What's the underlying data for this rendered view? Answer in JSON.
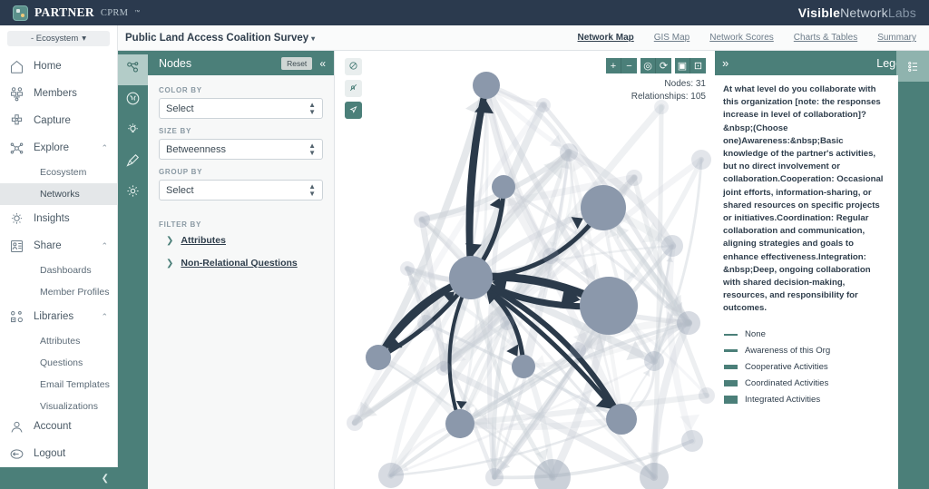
{
  "topbar": {
    "brand_name": "PARTNER",
    "brand_sub": "CPRM",
    "brand_tm": "™",
    "logo_icon": "partner-logo-icon",
    "right_brand": {
      "part1": "Visible",
      "part2": "Network",
      "part3": "Labs"
    }
  },
  "sidebar": {
    "ecosystem_selector": "- Ecosystem",
    "ecosystem_caret": "▾",
    "items": [
      {
        "label": "Home",
        "icon": "home-icon",
        "chevron": ""
      },
      {
        "label": "Members",
        "icon": "members-icon",
        "chevron": ""
      },
      {
        "label": "Capture",
        "icon": "capture-icon",
        "chevron": ""
      },
      {
        "label": "Explore",
        "icon": "explore-icon",
        "chevron": "⌃"
      },
      {
        "label": "Insights",
        "icon": "insights-icon",
        "chevron": ""
      },
      {
        "label": "Share",
        "icon": "share-icon",
        "chevron": "⌃"
      },
      {
        "label": "Libraries",
        "icon": "libraries-icon",
        "chevron": "⌃"
      }
    ],
    "explore_sub": [
      {
        "label": "Ecosystem",
        "active": false
      },
      {
        "label": "Networks",
        "active": true
      }
    ],
    "share_sub": [
      {
        "label": "Dashboards",
        "active": false
      },
      {
        "label": "Member Profiles",
        "active": false
      }
    ],
    "libraries_sub": [
      {
        "label": "Attributes",
        "active": false
      },
      {
        "label": "Questions",
        "active": false
      },
      {
        "label": "Email Templates",
        "active": false
      },
      {
        "label": "Visualizations",
        "active": false
      }
    ],
    "bottom_items": [
      {
        "label": "Account",
        "icon": "account-icon"
      },
      {
        "label": "Logout",
        "icon": "logout-icon"
      }
    ],
    "collapse_glyph": "❮"
  },
  "header": {
    "survey_title": "Public Land Access Coalition Survey",
    "survey_caret": "▾",
    "tabs": [
      {
        "label": "Network Map",
        "active": true
      },
      {
        "label": "GIS Map",
        "active": false
      },
      {
        "label": "Network Scores",
        "active": false
      },
      {
        "label": "Charts & Tables",
        "active": false
      },
      {
        "label": "Summary",
        "active": false
      }
    ]
  },
  "rail": [
    {
      "name": "nodes-tool",
      "icon": "network-nodes-icon",
      "active": true
    },
    {
      "name": "clusters-tool",
      "icon": "clusters-icon",
      "active": false
    },
    {
      "name": "insights-tool",
      "icon": "lightbulb-icon",
      "active": false
    },
    {
      "name": "style-tool",
      "icon": "paintbrush-icon",
      "active": false
    },
    {
      "name": "settings-tool",
      "icon": "gear-icon",
      "active": false
    }
  ],
  "nodes_panel": {
    "title": "Nodes",
    "reset_label": "Reset",
    "collapse_glyph": "«",
    "fields": [
      {
        "label": "COLOR BY",
        "value": "Select"
      },
      {
        "label": "SIZE BY",
        "value": "Betweenness"
      },
      {
        "label": "GROUP BY",
        "value": "Select"
      }
    ],
    "filter_heading": "FILTER BY",
    "filters": [
      {
        "caret": "❯",
        "label": "Attributes"
      },
      {
        "caret": "❯",
        "label": "Non-Relational Questions"
      }
    ]
  },
  "canvas": {
    "left_tools": [
      {
        "name": "hide-nodes-toggle",
        "glyph": "Ø",
        "active": false
      },
      {
        "name": "hide-labels-toggle",
        "glyph": "𝒶",
        "active": false
      },
      {
        "name": "pointer-tool",
        "glyph": "▷",
        "active": true
      }
    ],
    "right_tools": [
      {
        "name": "zoom-in-button",
        "glyph": "+"
      },
      {
        "name": "zoom-out-button",
        "glyph": "−"
      },
      {
        "name": "recenter-button",
        "glyph": "◎"
      },
      {
        "name": "refresh-layout-button",
        "glyph": "⟳"
      },
      {
        "name": "screenshot-button",
        "glyph": "▣"
      },
      {
        "name": "save-button",
        "glyph": "⊡"
      }
    ],
    "stats": {
      "nodes": "Nodes: 31",
      "relationships": "Relationships: 105"
    },
    "colors": {
      "node_fill": "#8b98ab",
      "highlight_edge": "#2b3a4a",
      "background_edge": "#c9cfd6"
    }
  },
  "legend": {
    "expand_glyph": "»",
    "title": "Legend",
    "panel_icon": "legend-list-icon",
    "description": "At what level do you collaborate with this organization [note: the responses increase in level of collaboration]?&nbsp;(Choose one)Awareness:&nbsp;Basic knowledge of the partner's activities, but no direct involvement or collaboration.Cooperation: Occasional joint efforts, information-sharing, or shared resources on specific projects or initiatives.Coordination: Regular collaboration and communication, aligning strategies and goals to enhance effectiveness.Integration: &nbsp;Deep, ongoing collaboration with shared decision-making, resources, and responsibility for outcomes.",
    "items": [
      {
        "label": "None",
        "thickness": 2
      },
      {
        "label": "Awareness of this Org",
        "thickness": 3
      },
      {
        "label": "Cooperative Activities",
        "thickness": 5
      },
      {
        "label": "Coordinated Activities",
        "thickness": 7
      },
      {
        "label": "Integrated Activities",
        "thickness": 9
      }
    ],
    "swatch_color": "#4b7f79"
  }
}
